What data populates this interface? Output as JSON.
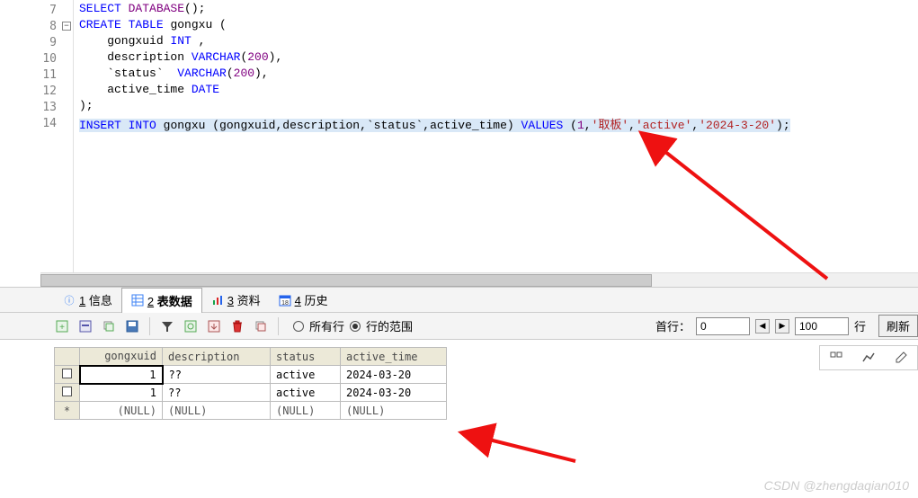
{
  "editor": {
    "lines": [
      {
        "num": "7",
        "tokens": [
          {
            "t": "SELECT",
            "c": "kw-blue"
          },
          {
            "t": " ",
            "c": ""
          },
          {
            "t": "DATABASE",
            "c": "kw-purple"
          },
          {
            "t": "();",
            "c": "ident"
          }
        ]
      },
      {
        "num": "8",
        "fold": true,
        "tokens": [
          {
            "t": "CREATE",
            "c": "kw-blue"
          },
          {
            "t": " ",
            "c": ""
          },
          {
            "t": "TABLE",
            "c": "kw-blue"
          },
          {
            "t": " gongxu (",
            "c": "ident"
          }
        ]
      },
      {
        "num": "9",
        "tokens": [
          {
            "t": "    gongxuid ",
            "c": "ident"
          },
          {
            "t": "INT",
            "c": "kw-blue"
          },
          {
            "t": " ,",
            "c": "ident"
          }
        ]
      },
      {
        "num": "10",
        "tokens": [
          {
            "t": "    description ",
            "c": "ident"
          },
          {
            "t": "VARCHAR",
            "c": "kw-blue"
          },
          {
            "t": "(",
            "c": ""
          },
          {
            "t": "200",
            "c": "kw-purple"
          },
          {
            "t": "),",
            "c": ""
          }
        ]
      },
      {
        "num": "11",
        "tokens": [
          {
            "t": "    `status`  ",
            "c": "ident"
          },
          {
            "t": "VARCHAR",
            "c": "kw-blue"
          },
          {
            "t": "(",
            "c": ""
          },
          {
            "t": "200",
            "c": "kw-purple"
          },
          {
            "t": "),",
            "c": ""
          }
        ]
      },
      {
        "num": "12",
        "tokens": [
          {
            "t": "    active_time ",
            "c": "ident"
          },
          {
            "t": "DATE",
            "c": "kw-blue"
          }
        ]
      },
      {
        "num": "13",
        "tokens": [
          {
            "t": ");",
            "c": "ident"
          }
        ]
      },
      {
        "num": "14",
        "sel": true,
        "tokens": [
          {
            "t": "INSERT",
            "c": "kw-blue"
          },
          {
            "t": " ",
            "c": ""
          },
          {
            "t": "INTO",
            "c": "kw-blue"
          },
          {
            "t": " gongxu (gongxuid,description,`status`,active_time) ",
            "c": "ident"
          },
          {
            "t": "VALUES",
            "c": "kw-blue"
          },
          {
            "t": " (",
            "c": "ident"
          },
          {
            "t": "1",
            "c": "kw-purple"
          },
          {
            "t": ",",
            "c": ""
          },
          {
            "t": "'取板'",
            "c": "str-red"
          },
          {
            "t": ",",
            "c": ""
          },
          {
            "t": "'active'",
            "c": "str-red"
          },
          {
            "t": ",",
            "c": ""
          },
          {
            "t": "'2024-3-20'",
            "c": "str-red"
          },
          {
            "t": ");",
            "c": ""
          }
        ]
      }
    ]
  },
  "tabs": {
    "items": [
      {
        "num": "1",
        "label": "信息",
        "icon": "info"
      },
      {
        "num": "2",
        "label": "表数据",
        "icon": "table",
        "active": true
      },
      {
        "num": "3",
        "label": "资料",
        "icon": "chart"
      },
      {
        "num": "4",
        "label": "历史",
        "icon": "cal"
      }
    ]
  },
  "toolbar": {
    "radio_all": "所有行",
    "radio_range": "行的范围",
    "first_row_label": "首行：",
    "first_row_value": "0",
    "limit_value": "100",
    "limit_label": "行",
    "refresh": "刷新"
  },
  "grid": {
    "headers": [
      "gongxuid",
      "description",
      "status",
      "active_time"
    ],
    "rows": [
      {
        "marker": "check",
        "focus": true,
        "cells": [
          "1",
          "??",
          "active",
          "2024-03-20"
        ]
      },
      {
        "marker": "check",
        "cells": [
          "1",
          "??",
          "active",
          "2024-03-20"
        ]
      },
      {
        "marker": "star",
        "cells": [
          "(NULL)",
          "(NULL)",
          "(NULL)",
          "(NULL)"
        ]
      }
    ]
  },
  "watermark": "CSDN @zhengdaqian010"
}
